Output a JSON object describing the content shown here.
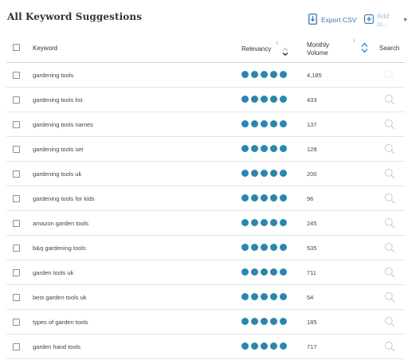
{
  "title": "All Keyword Suggestions",
  "toolbar": {
    "export_label": "Export CSV",
    "addto_label": "Add to..."
  },
  "columns": {
    "keyword": "Keyword",
    "relevancy": "Relevancy",
    "info_mark": "i",
    "volume_line1": "Monthly",
    "volume_line2": "Volume",
    "search": "Search"
  },
  "rows": [
    {
      "keyword": "gardening tools",
      "relevancy": 5,
      "volume": "4,185"
    },
    {
      "keyword": "gardening tools list",
      "relevancy": 5,
      "volume": "433"
    },
    {
      "keyword": "gardening tools names",
      "relevancy": 5,
      "volume": "137"
    },
    {
      "keyword": "gardening tools set",
      "relevancy": 5,
      "volume": "128"
    },
    {
      "keyword": "gardening tools uk",
      "relevancy": 5,
      "volume": "200"
    },
    {
      "keyword": "gardening tools for kids",
      "relevancy": 5,
      "volume": "96"
    },
    {
      "keyword": "amazon garden tools",
      "relevancy": 5,
      "volume": "245"
    },
    {
      "keyword": "b&q gardening tools",
      "relevancy": 5,
      "volume": "535"
    },
    {
      "keyword": "garden tools uk",
      "relevancy": 5,
      "volume": "711"
    },
    {
      "keyword": "best garden tools uk",
      "relevancy": 5,
      "volume": "54"
    },
    {
      "keyword": "types of garden tools",
      "relevancy": 5,
      "volume": "185"
    },
    {
      "keyword": "garden hand tools",
      "relevancy": 5,
      "volume": "717"
    }
  ],
  "colors": {
    "accent": "#3a78b8",
    "relevancy_dot": "#2b86b0",
    "muted_search": "#d0d5da"
  },
  "icons": {
    "export": "export-file-icon",
    "add": "plus-box-icon",
    "sort": "sort-arrows-icon",
    "search": "magnifier-icon"
  }
}
